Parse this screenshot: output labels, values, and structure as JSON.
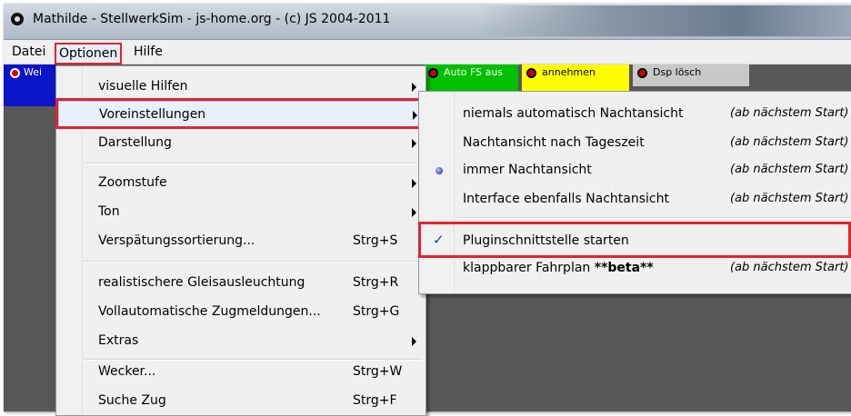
{
  "window": {
    "title": "Mathilde - StellwerkSim - js-home.org - (c) JS 2004-2011"
  },
  "menubar": {
    "items": [
      "Datei",
      "Optionen",
      "Hilfe"
    ]
  },
  "background": {
    "blue_label": "Wei",
    "tiles": [
      "Auto FS aus",
      "annehmen",
      "Dsp lösch"
    ],
    "colors": {
      "blue": "#0a14c8",
      "green": "#00c000",
      "yellow": "#ffff00",
      "grey": "#c8c8c8",
      "led": "#d10000"
    }
  },
  "optionen_menu": {
    "items": [
      {
        "label": "visuelle Hilfen",
        "accel": "",
        "submenu": true
      },
      {
        "label": "Voreinstellungen",
        "accel": "",
        "submenu": true,
        "highlighted": true
      },
      {
        "label": "Darstellung",
        "accel": "",
        "submenu": true
      },
      {
        "label": "Zoomstufe",
        "accel": "",
        "submenu": true
      },
      {
        "label": "Ton",
        "accel": "",
        "submenu": true
      },
      {
        "label": "Verspätungssortierung...",
        "accel": "Strg+S",
        "submenu": false
      },
      {
        "label": "realistischere Gleisausleuchtung",
        "accel": "Strg+R",
        "submenu": false
      },
      {
        "label": "Vollautomatische Zugmeldungen...",
        "accel": "Strg+G",
        "submenu": false
      },
      {
        "label": "Extras",
        "accel": "",
        "submenu": true
      },
      {
        "label": "Wecker...",
        "accel": "Strg+W",
        "submenu": false
      },
      {
        "label": "Suche Zug",
        "accel": "Strg+F",
        "submenu": false
      }
    ]
  },
  "voreinstellungen_submenu": {
    "items": [
      {
        "label": "niemals automatisch Nachtansicht",
        "note": "(ab nächstem Start)",
        "mark": ""
      },
      {
        "label": "Nachtansicht nach Tageszeit",
        "note": "(ab nächstem Start)",
        "mark": ""
      },
      {
        "label": "immer Nachtansicht",
        "note": "(ab nächstem Start)",
        "mark": "radio"
      },
      {
        "label": "Interface ebenfalls Nachtansicht",
        "note": "(ab nächstem Start)",
        "mark": ""
      },
      {
        "label": "Pluginschnittstelle starten",
        "note": "",
        "mark": "check"
      },
      {
        "label_plain": "klappbarer Fahrplan ",
        "label_bold": "**beta**",
        "note": "(ab nächstem Start)",
        "mark": ""
      }
    ]
  },
  "accent": {
    "highlight_box": "#e3232f"
  }
}
